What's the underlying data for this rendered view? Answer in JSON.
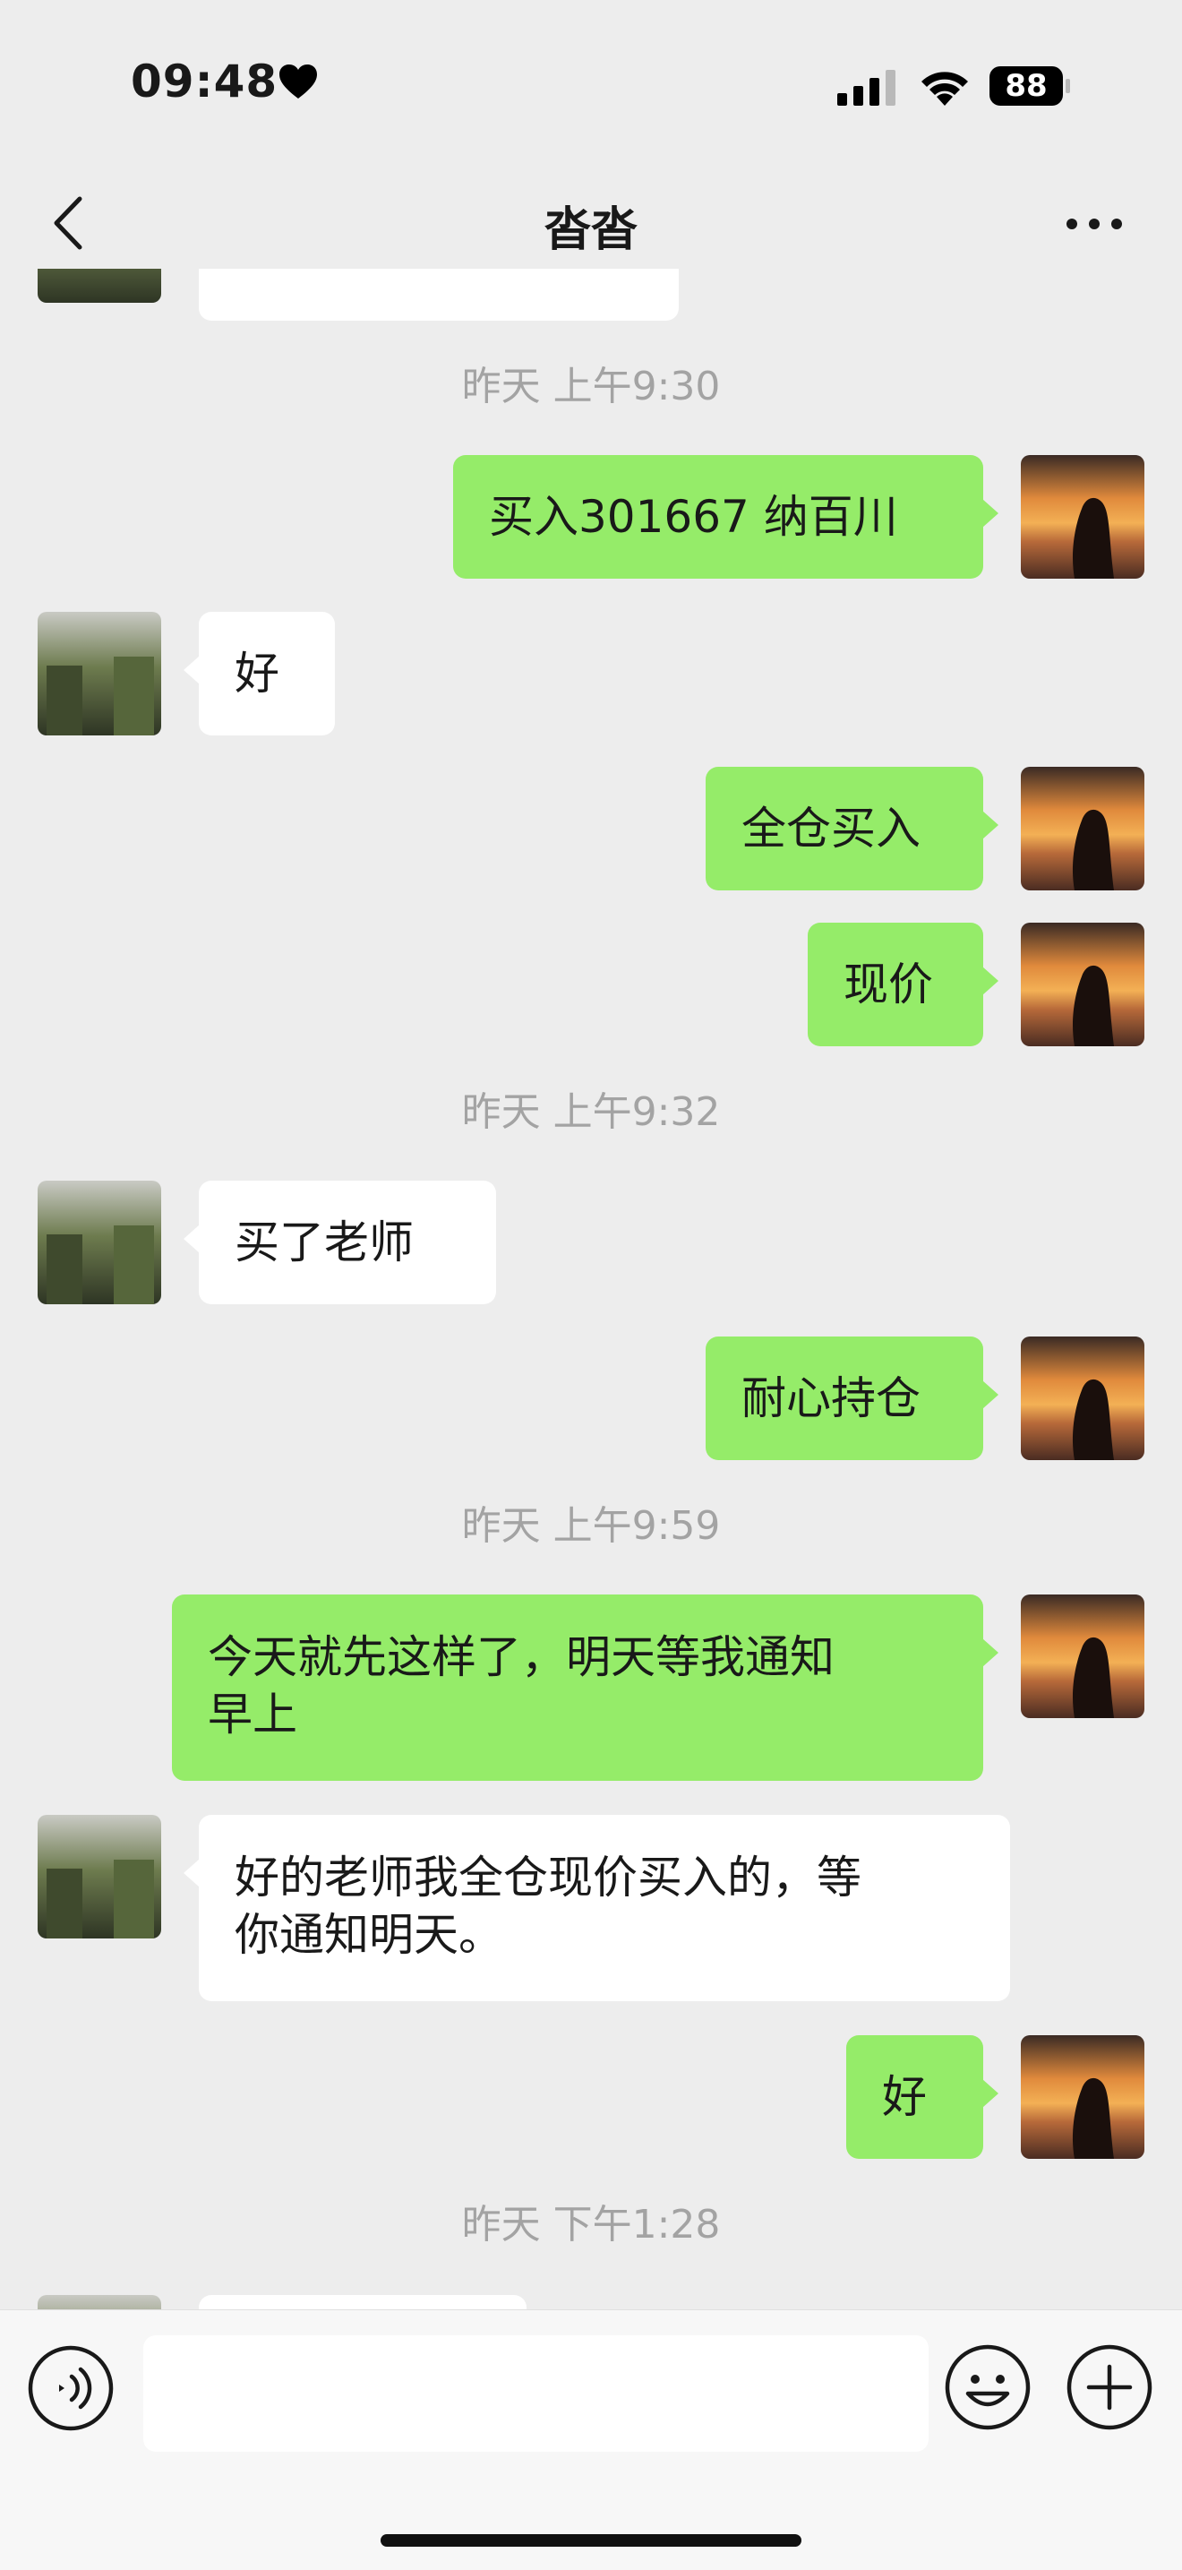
{
  "status": {
    "time": "09:48",
    "battery": "88"
  },
  "nav": {
    "title": "沓沓"
  },
  "timestamps": {
    "t1": "昨天 上午9:30",
    "t2": "昨天 上午9:32",
    "t3": "昨天 上午9:59",
    "t4": "昨天 下午1:28"
  },
  "messages": {
    "m1": "买入301667 纳百川",
    "m2": "好",
    "m3": "全仓买入",
    "m4": "现价",
    "m5": "买了老师",
    "m6": "耐心持仓",
    "m7": "今天就先这样了，明天等我通知\n早上",
    "m8": "好的老师我全仓现价买入的，等\n你通知明天。",
    "m9": "好"
  },
  "colors": {
    "sent_bubble": "#95ec69",
    "received_bubble": "#ffffff",
    "background": "#ededed"
  },
  "icons": [
    "heart-icon",
    "signal-icon",
    "wifi-icon",
    "battery-icon",
    "back-icon",
    "more-icon",
    "voice-icon",
    "emoji-icon",
    "plus-icon"
  ]
}
